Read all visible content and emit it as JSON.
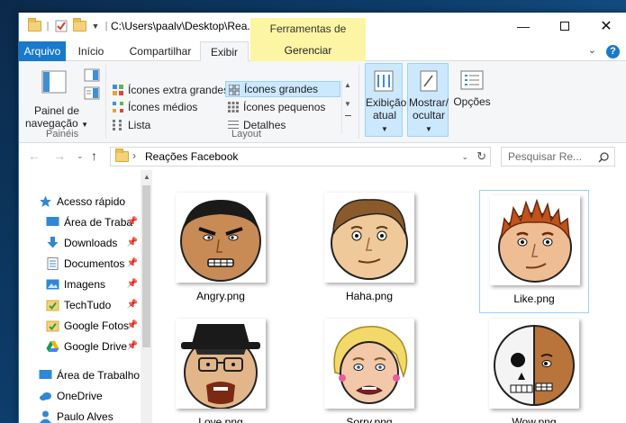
{
  "window": {
    "path": "C:\\Users\\paalv\\Desktop\\Rea...",
    "contextual_tab": "Ferramentas de Imagem",
    "contextual_sub": "Gerenciar"
  },
  "tabs": [
    {
      "label": "Arquivo"
    },
    {
      "label": "Início"
    },
    {
      "label": "Compartilhar"
    },
    {
      "label": "Exibir"
    }
  ],
  "ribbon": {
    "panes": {
      "nav_pane_label": "Painel de navegação",
      "group": "Painéis"
    },
    "layout": {
      "group": "Layout",
      "options": [
        {
          "label": "Ícones extra grandes",
          "selected": false
        },
        {
          "label": "Ícones grandes",
          "selected": true
        },
        {
          "label": "Ícones médios",
          "selected": false
        },
        {
          "label": "Ícones pequenos",
          "selected": false
        },
        {
          "label": "Lista",
          "selected": false
        },
        {
          "label": "Detalhes",
          "selected": false
        }
      ]
    },
    "current_view": "Exibição atual",
    "show_hide": "Mostrar/ ocultar",
    "options": "Opções"
  },
  "address": {
    "folder": "Reações Facebook",
    "search_placeholder": "Pesquisar Re..."
  },
  "sidebar": {
    "quick_access": "Acesso rápido",
    "items": [
      {
        "label": "Área de Traba",
        "pinned": true
      },
      {
        "label": "Downloads",
        "pinned": true
      },
      {
        "label": "Documentos",
        "pinned": true
      },
      {
        "label": "Imagens",
        "pinned": true
      },
      {
        "label": "TechTudo",
        "pinned": true
      },
      {
        "label": "Google Fotos",
        "pinned": true
      },
      {
        "label": "Google Drive",
        "pinned": true
      }
    ],
    "desktop": "Área de Trabalho",
    "onedrive": "OneDrive",
    "user": "Paulo Alves"
  },
  "files": [
    {
      "name": "Angry.png",
      "selected": false
    },
    {
      "name": "Haha.png",
      "selected": false
    },
    {
      "name": "Like.png",
      "selected": true
    },
    {
      "name": "Love.png",
      "selected": false
    },
    {
      "name": "Sorry.png",
      "selected": false
    },
    {
      "name": "Wow.png",
      "selected": false
    }
  ],
  "colors": {
    "accent": "#1979ca",
    "context_tab": "#fcf5a4",
    "selection": "#cce8ff"
  }
}
